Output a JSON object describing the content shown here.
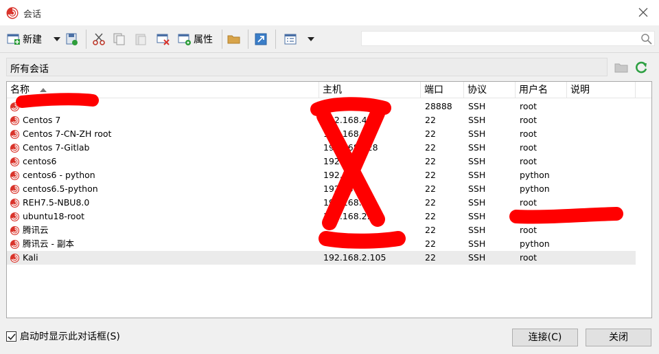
{
  "window": {
    "title": "会话",
    "icon": "session-app-icon"
  },
  "toolbar": {
    "new_label": "新建",
    "properties_label": "属性",
    "buttons": [
      "new-session-icon",
      "new-dropdown-arrow",
      "save-session-icon",
      "cut-icon",
      "copy-icon",
      "paste-icon",
      "delete-icon",
      "properties-icon",
      "open-folder-icon",
      "shortcut-icon",
      "view-icon",
      "view-dropdown-arrow"
    ]
  },
  "search": {
    "placeholder": "",
    "icon": "search-icon"
  },
  "pathbar": {
    "path": "所有会话",
    "buttons": [
      "folder-up-icon",
      "refresh-icon"
    ]
  },
  "table": {
    "columns": [
      "名称",
      "主机",
      "端口",
      "协议",
      "用户名",
      "说明"
    ],
    "sort_column": "名称",
    "rows": [
      {
        "name": "",
        "host": "",
        "port": "28888",
        "protocol": "SSH",
        "user": "root",
        "desc": ""
      },
      {
        "name": "Centos 7",
        "host": "192.168.47",
        "port": "22",
        "protocol": "SSH",
        "user": "root",
        "desc": ""
      },
      {
        "name": "Centos 7-CN-ZH root",
        "host": "192.168.2",
        "port": "22",
        "protocol": "SSH",
        "user": "root",
        "desc": ""
      },
      {
        "name": "Centos 7-Gitlab",
        "host": "192.168.128",
        "port": "22",
        "protocol": "SSH",
        "user": "root",
        "desc": ""
      },
      {
        "name": "centos6",
        "host": "192.129",
        "port": "22",
        "protocol": "SSH",
        "user": "root",
        "desc": ""
      },
      {
        "name": "centos6 - python",
        "host": "192.129",
        "port": "22",
        "protocol": "SSH",
        "user": "python",
        "desc": ""
      },
      {
        "name": "centos6.5-python",
        "host": "192.15",
        "port": "22",
        "protocol": "SSH",
        "user": "python",
        "desc": ""
      },
      {
        "name": "REH7.5-NBU8.0",
        "host": "192.168.",
        "port": "22",
        "protocol": "SSH",
        "user": "root",
        "desc": ""
      },
      {
        "name": "ubuntu18-root",
        "host": "192.168.2.",
        "port": "22",
        "protocol": "SSH",
        "user": "",
        "desc": ""
      },
      {
        "name": "腾讯云",
        "host": "",
        "port": "22",
        "protocol": "SSH",
        "user": "root",
        "desc": ""
      },
      {
        "name": "腾讯云 - 副本",
        "host": "",
        "port": "22",
        "protocol": "SSH",
        "user": "python",
        "desc": ""
      },
      {
        "name": "Kali",
        "host": "192.168.2.105",
        "port": "22",
        "protocol": "SSH",
        "user": "root",
        "desc": ""
      }
    ],
    "selected_row": 11
  },
  "footer": {
    "show_on_startup": "启动时显示此对话框(S)",
    "show_on_startup_checked": true,
    "connect_label": "连接(C)",
    "close_label": "关闭"
  },
  "colors": {
    "session_icon": "#d9342b",
    "redaction": "#ff0000",
    "refresh": "#2ea043",
    "selected_row": "#ebebeb"
  }
}
